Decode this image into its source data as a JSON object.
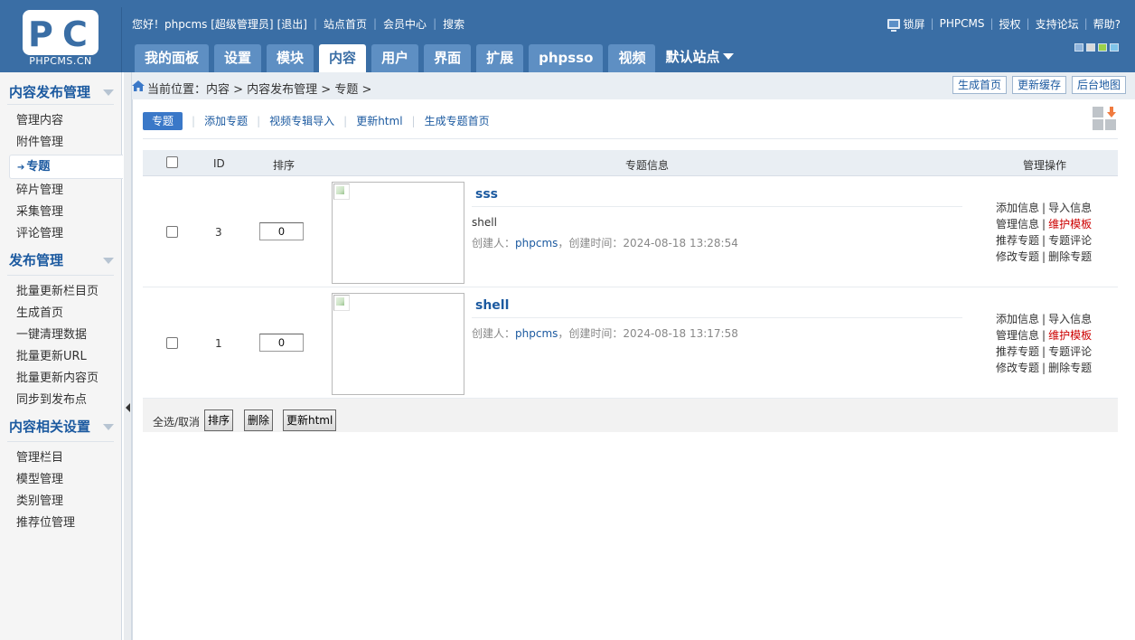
{
  "logo": {
    "brand": "PHPCMS.CN"
  },
  "top": {
    "greeting": "您好！phpcms [超级管理员]",
    "logout": "[退出]",
    "site_home": "站点首页",
    "member_center": "会员中心",
    "search": "搜索"
  },
  "toplinks": {
    "lock": "锁屏",
    "phpcms": "PHPCMS",
    "license": "授权",
    "forum": "支持论坛",
    "help": "帮助?"
  },
  "skins": [
    "#8fb4dc",
    "#d9d9d9",
    "#9bd14a",
    "#7ec4ea"
  ],
  "nav": {
    "tabs": [
      "我的面板",
      "设置",
      "模块",
      "内容",
      "用户",
      "界面",
      "扩展",
      "phpsso",
      "视频"
    ],
    "active_index": 3,
    "site": "默认站点"
  },
  "sidebar": {
    "groups": [
      {
        "title": "内容发布管理",
        "items": [
          "管理内容",
          "附件管理",
          "专题",
          "碎片管理",
          "采集管理",
          "评论管理"
        ],
        "active": "专题"
      },
      {
        "title": "发布管理",
        "items": [
          "批量更新栏目页",
          "生成首页",
          "一键清理数据",
          "批量更新URL",
          "批量更新内容页",
          "同步到发布点"
        ]
      },
      {
        "title": "内容相关设置",
        "items": [
          "管理栏目",
          "模型管理",
          "类别管理",
          "推荐位管理"
        ]
      }
    ]
  },
  "breadcrumb": {
    "text": "当前位置：内容 > 内容发布管理 > 专题 >",
    "buttons": [
      "生成首页",
      "更新缓存",
      "后台地图"
    ]
  },
  "subnav": {
    "active": "专题",
    "links": [
      "添加专题",
      "视频专辑导入",
      "更新html",
      "生成专题首页"
    ]
  },
  "table": {
    "headers": {
      "id": "ID",
      "order": "排序",
      "info": "专题信息",
      "ops": "管理操作"
    },
    "rows": [
      {
        "id": "3",
        "order": "0",
        "title": "sss",
        "description": "shell",
        "creator_label": "创建人：",
        "creator": "phpcms",
        "time_label": "，创建时间：",
        "created": "2024-08-18 13:28:54"
      },
      {
        "id": "1",
        "order": "0",
        "title": "shell",
        "description": "",
        "creator_label": "创建人：",
        "creator": "phpcms",
        "time_label": "，创建时间：",
        "created": "2024-08-18 13:17:58"
      }
    ],
    "ops": {
      "add_info": "添加信息",
      "import_info": "导入信息",
      "manage_info": "管理信息",
      "maintain_template": "维护模板",
      "recommend": "推荐专题",
      "comments": "专题评论",
      "edit": "修改专题",
      "delete": "删除专题"
    }
  },
  "footer": {
    "select_all": "全选/取消",
    "buttons": [
      "排序",
      "删除",
      "更新html"
    ]
  },
  "colors": {
    "header": "#3a6ea5",
    "link": "#1c5aa0",
    "danger": "#cc0000"
  }
}
